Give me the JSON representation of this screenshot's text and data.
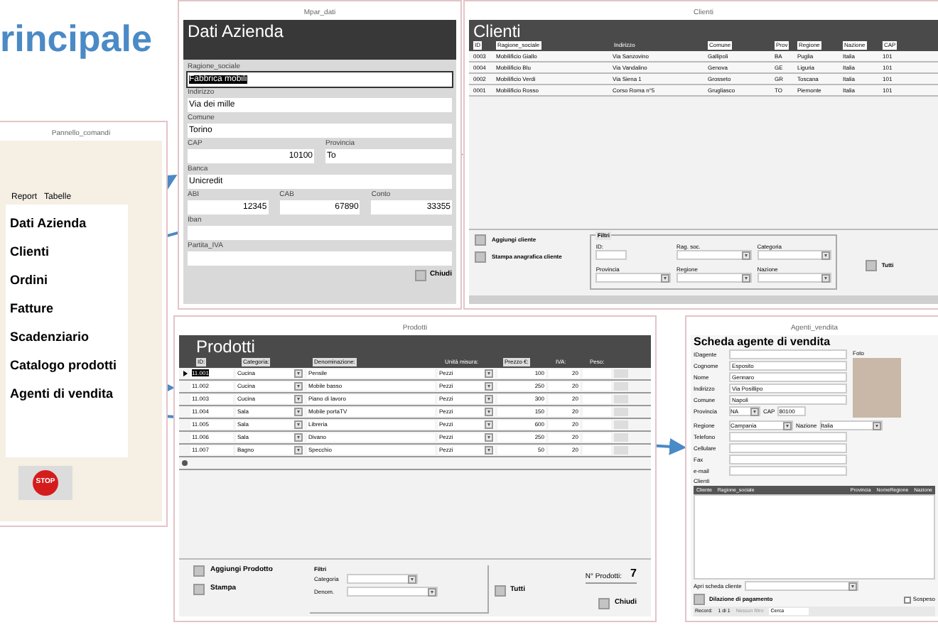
{
  "title": "rincipale",
  "pannello": {
    "window_title": "Pannello_comandi",
    "tabs": [
      {
        "label": "Report",
        "selected": false
      },
      {
        "label": "Tabelle",
        "selected": false
      }
    ],
    "items": [
      "Dati Azienda",
      "Clienti",
      "Ordini",
      "Fatture",
      "Scadenziario",
      "Catalogo prodotti",
      "Agenti di vendita"
    ],
    "stop": "STOP"
  },
  "dati": {
    "window_title": "Mpar_dati",
    "heading": "Dati Azienda",
    "rows": [
      [
        {
          "label": "Ragione_sociale",
          "value": "Fabbrica mobili",
          "selected": true,
          "kind": "text"
        }
      ],
      [
        {
          "label": "Indirizzo",
          "value": "Via dei mille",
          "selected": false,
          "kind": "text"
        }
      ],
      [
        {
          "label": "Comune",
          "value": "Torino",
          "selected": false,
          "kind": "text"
        }
      ],
      [
        {
          "label": "CAP",
          "value": "10100",
          "selected": false,
          "kind": "number"
        },
        {
          "label": "Provincia",
          "value": "To",
          "selected": false,
          "kind": "text"
        }
      ],
      [
        {
          "label": "Banca",
          "value": "Unicredit",
          "selected": false,
          "kind": "text"
        }
      ],
      [
        {
          "label": "ABI",
          "value": "12345",
          "selected": false,
          "kind": "number"
        },
        {
          "label": "CAB",
          "value": "67890",
          "selected": false,
          "kind": "number"
        },
        {
          "label": "Conto",
          "value": "33355",
          "selected": false,
          "kind": "number"
        }
      ],
      [
        {
          "label": "Iban",
          "selected": false,
          "kind": "text"
        }
      ],
      [
        {
          "label": "Partita_IVA",
          "selected": false,
          "kind": "text"
        }
      ]
    ],
    "close": "Chiudi"
  },
  "clienti": {
    "window_title": "Clienti",
    "heading": "Clienti",
    "columns": [
      "ID",
      "Ragione_sociale",
      "Indirizzo",
      "Comune",
      "Prov",
      "Regione",
      "Nazione",
      "CAP"
    ],
    "rows": [
      [
        "0003",
        "Mobilificio Giallo",
        "Via Sanzovino",
        "Gallipoli",
        "BA",
        "Puglia",
        "Italia",
        "101"
      ],
      [
        "0004",
        "Mobilificio Blu",
        "Via Vandalino",
        "Genova",
        "GE",
        "Liguria",
        "Italia",
        "101"
      ],
      [
        "0002",
        "Mobilificio Verdi",
        "Via Siena 1",
        "Grosseto",
        "GR",
        "Toscana",
        "Italia",
        "101"
      ],
      [
        "0001",
        "Mobilificio Rosso",
        "Corso Roma n°5",
        "Grugliasco",
        "TO",
        "Piemonte",
        "Italia",
        "101"
      ]
    ],
    "buttons": [
      "Aggiungi cliente",
      "Stampa anagrafica cliente"
    ],
    "filter_title": "Filtri",
    "filters": [
      {
        "label": "ID:",
        "kind": "text"
      },
      {
        "label": "Rag. soc.",
        "kind": "combo"
      },
      {
        "label": "Categoria",
        "kind": "combo"
      },
      {
        "label": "Provincia",
        "kind": "combo"
      },
      {
        "label": "Regione",
        "kind": "combo"
      },
      {
        "label": "Nazione",
        "kind": "combo"
      }
    ],
    "all": "Tutti"
  },
  "prodotti": {
    "window_title": "Prodotti",
    "heading": "Prodotti",
    "columns": [
      "ID:",
      "Categoria:",
      "Denominazione:",
      "Unità misura:",
      "Prezzo €:",
      "IVA:",
      "Peso:"
    ],
    "rows": [
      {
        "cells": [
          "11.001",
          "Cucina",
          "Pensile",
          "Pezzi",
          "100",
          "20"
        ],
        "selected": true
      },
      {
        "cells": [
          "11.002",
          "Cucina",
          "Mobile basso",
          "Pezzi",
          "250",
          "20"
        ],
        "selected": false
      },
      {
        "cells": [
          "11.003",
          "Cucina",
          "Piano di lavoro",
          "Pezzi",
          "300",
          "20"
        ],
        "selected": false
      },
      {
        "cells": [
          "11.004",
          "Sala",
          "Mobile portaTV",
          "Pezzi",
          "150",
          "20"
        ],
        "selected": false
      },
      {
        "cells": [
          "11.005",
          "Sala",
          "Libreria",
          "Pezzi",
          "600",
          "20"
        ],
        "selected": false
      },
      {
        "cells": [
          "11.006",
          "Sala",
          "Divano",
          "Pezzi",
          "250",
          "20"
        ],
        "selected": false
      },
      {
        "cells": [
          "11.007",
          "Bagno",
          "Specchio",
          "Pezzi",
          "50",
          "20"
        ],
        "selected": false
      }
    ],
    "buttons": [
      "Aggiungi Prodotto",
      "Stampa"
    ],
    "filter_title": "Filtri",
    "filters": [
      "Categoria",
      "Denom."
    ],
    "all": "Tutti",
    "count_label": "N° Prodotti:",
    "count": "7",
    "close": "Chiudi"
  },
  "agenti": {
    "window_title": "Agenti_vendita",
    "heading": "Scheda agente di vendita",
    "photo_label": "Foto",
    "fields": [
      {
        "label": "IDagente"
      },
      {
        "label": "Cognome",
        "value": "Esposito"
      },
      {
        "label": "Nome",
        "value": "Gennaro"
      },
      {
        "label": "Indirizzo",
        "value": "Via Posillipo"
      },
      {
        "label": "Comune",
        "value": "Napoli"
      }
    ],
    "provincia": {
      "label": "Provincia",
      "value": "NA",
      "cap_label": "CAP",
      "cap": "80100"
    },
    "regione": {
      "label": "Regione",
      "value": "Campania",
      "nazione_label": "Nazione",
      "nazione": "Italia"
    },
    "contacts": [
      "Telefono",
      "Cellulare",
      "Fax",
      "e-mail"
    ],
    "sub_label": "Clienti",
    "sub_columns": [
      "Cliente",
      "Ragione_sociale",
      "Provincia",
      "NomeRegione",
      "Nazione"
    ],
    "open_label": "Apri scheda cliente",
    "button": "Dilazione di pagamento",
    "suspended": {
      "label": "Sospeso",
      "checked": false
    },
    "nav": {
      "label": "Record:",
      "position": "1 di 1",
      "filter": "Nessun filtro",
      "search": "Cerca"
    }
  }
}
